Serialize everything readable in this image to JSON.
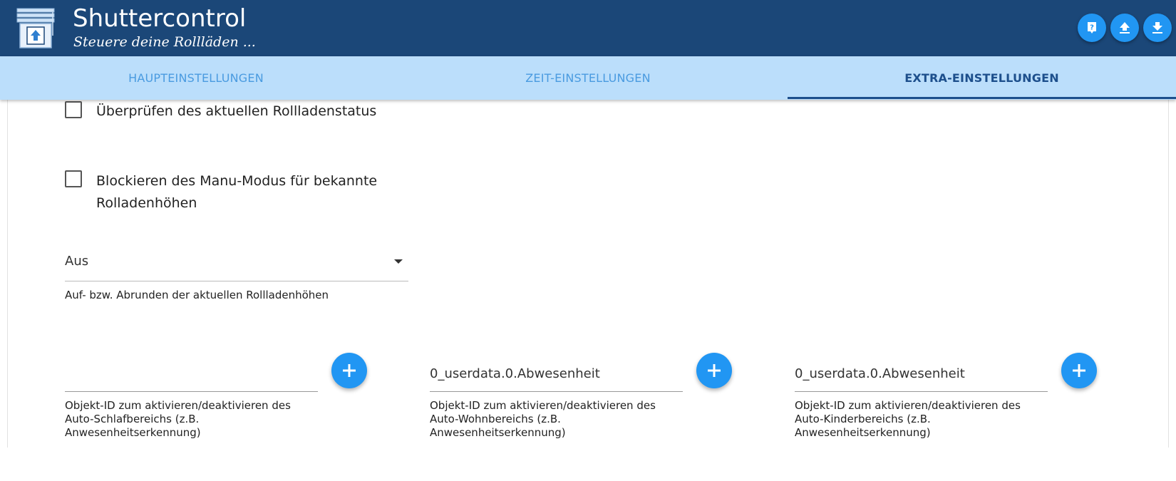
{
  "header": {
    "title": "Shuttercontrol",
    "subtitle": "Steuere deine Rollläden ...",
    "buttons": [
      {
        "icon": "help-icon"
      },
      {
        "icon": "upload-icon"
      },
      {
        "icon": "download-icon"
      }
    ]
  },
  "tabs": [
    {
      "label": "HAUPTEINSTELLUNGEN",
      "active": false
    },
    {
      "label": "ZEIT-EINSTELLUNGEN",
      "active": false
    },
    {
      "label": "EXTRA-EINSTELLUNGEN",
      "active": true
    }
  ],
  "settings": {
    "check_status": {
      "label": "Überprüfen des aktuellen Rollladenstatus",
      "checked": false
    },
    "block_manu": {
      "label_line1": "Blockieren des Manu-Modus für bekannte",
      "label_line2": "Rolladenhöhen",
      "checked": false
    },
    "rounding": {
      "value": "Aus",
      "helper": "Auf- bzw. Abrunden der aktuellen Rollladenhöhen"
    }
  },
  "object_fields": [
    {
      "value": "",
      "helper_line1": "Objekt-ID zum aktivieren/deaktivieren des",
      "helper_line2": "Auto-Schlafbereichs (z.B.",
      "helper_line3": "Anwesenheitserkennung)"
    },
    {
      "value": "0_userdata.0.Abwesenheit",
      "helper_line1": "Objekt-ID zum aktivieren/deaktivieren des",
      "helper_line2": "Auto-Wohnbereichs (z.B.",
      "helper_line3": "Anwesenheitserkennung)"
    },
    {
      "value": "0_userdata.0.Abwesenheit",
      "helper_line1": "Objekt-ID zum aktivieren/deaktivieren des",
      "helper_line2": "Auto-Kinderbereichs (z.B.",
      "helper_line3": "Anwesenheitserkennung)"
    }
  ],
  "colors": {
    "header_bg": "#1b4778",
    "tab_bar_bg": "#bbdefb",
    "tab_active": "#1d4f8c",
    "tab_inactive": "#4a9be0",
    "accent": "#2196f3"
  }
}
